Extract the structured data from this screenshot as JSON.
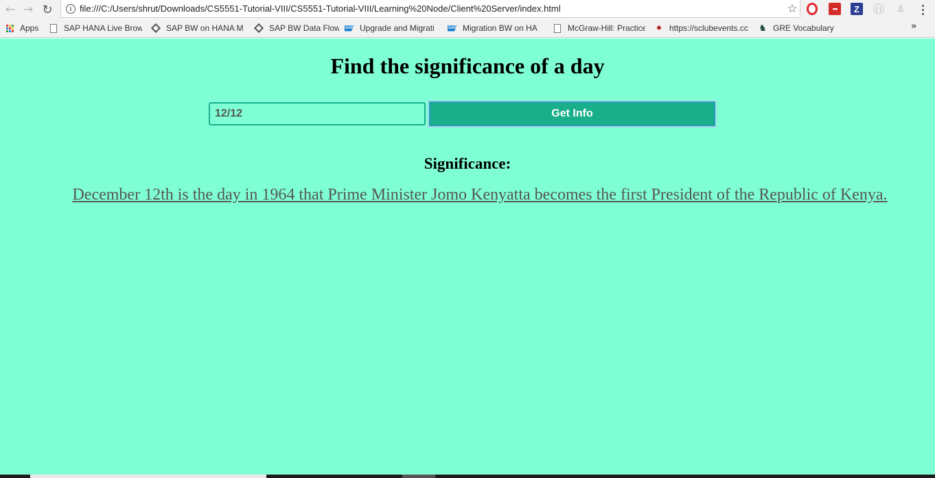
{
  "browser": {
    "url": "file:///C:/Users/shrut/Downloads/CS5551-Tutorial-VIII/CS5551-Tutorial-VIII/Learning%20Node/Client%20Server/index.html",
    "back_icon": "arrow-left-icon",
    "forward_icon": "arrow-right-icon",
    "reload_icon": "reload-icon",
    "extensions": [
      "opera-icon",
      "lastpass-icon",
      "zotero-icon",
      "extension-icon",
      "person-icon"
    ],
    "lastpass_glyph": "•••",
    "zotero_glyph": "Z"
  },
  "bookmarks": [
    {
      "label": "Apps",
      "icon": "apps-grid-icon"
    },
    {
      "label": "SAP HANA Live Brow",
      "icon": "page-icon"
    },
    {
      "label": "SAP BW on HANA M",
      "icon": "diamond-icon"
    },
    {
      "label": "SAP BW Data Flow",
      "icon": "diamond-icon"
    },
    {
      "label": "Upgrade and Migrati",
      "icon": "sap-icon"
    },
    {
      "label": "Migration BW on HA",
      "icon": "sap-icon"
    },
    {
      "label": "McGraw-Hill: Practice",
      "icon": "page-icon"
    },
    {
      "label": "https://sclubevents.cc",
      "icon": "bug-icon"
    },
    {
      "label": "GRE Vocabulary",
      "icon": "spartan-icon"
    }
  ],
  "bookmarks_more": "»",
  "page": {
    "title": "Find the significance of a day",
    "date_value": "12/12",
    "button_label": "Get Info",
    "significance_heading": "Significance:",
    "significance_text": "December 12th is the day in 1964 that Prime Minister Jomo Kenyatta becomes the first President of the Republic of Kenya."
  },
  "colors": {
    "page_background": "#7fffd4",
    "accent": "#1aaf8b",
    "result_text": "#555555"
  }
}
